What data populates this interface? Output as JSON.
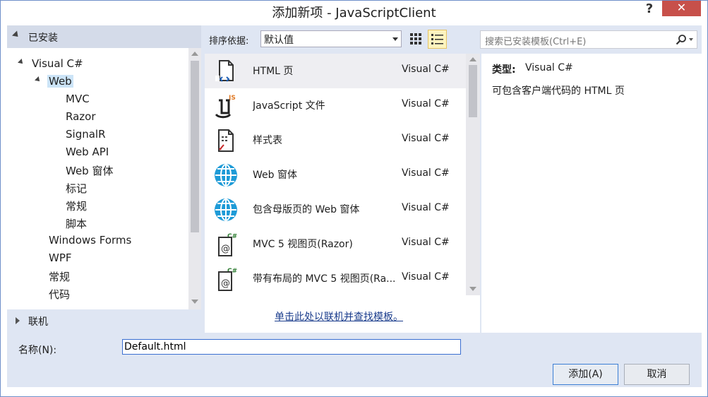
{
  "window": {
    "title": "添加新项 - JavaScriptClient",
    "help_label": "?",
    "close_label": "✕"
  },
  "left": {
    "installed_label": "已安装",
    "tree": [
      {
        "label": "Visual C#",
        "level": 0,
        "expanded": true
      },
      {
        "label": "Web",
        "level": 1,
        "expanded": true,
        "selected": true
      },
      {
        "label": "MVC",
        "level": 2
      },
      {
        "label": "Razor",
        "level": 2
      },
      {
        "label": "SignalR",
        "level": 2
      },
      {
        "label": "Web API",
        "level": 2
      },
      {
        "label": "Web 窗体",
        "level": 2
      },
      {
        "label": "标记",
        "level": 2
      },
      {
        "label": "常规",
        "level": 2
      },
      {
        "label": "脚本",
        "level": 2
      },
      {
        "label": "Windows Forms",
        "level": 1
      },
      {
        "label": "WPF",
        "level": 1
      },
      {
        "label": "常规",
        "level": 1
      },
      {
        "label": "代码",
        "level": 1
      }
    ],
    "online_label": "联机"
  },
  "toolbar": {
    "sort_label": "排序依据:",
    "sort_value": "默认值"
  },
  "templates": [
    {
      "name": "HTML 页",
      "type": "Visual C#",
      "icon": "html-page-icon",
      "selected": true
    },
    {
      "name": "JavaScript 文件",
      "type": "Visual C#",
      "icon": "javascript-file-icon"
    },
    {
      "name": "样式表",
      "type": "Visual C#",
      "icon": "stylesheet-icon"
    },
    {
      "name": "Web 窗体",
      "type": "Visual C#",
      "icon": "globe-icon"
    },
    {
      "name": "包含母版页的 Web 窗体",
      "type": "Visual C#",
      "icon": "globe-icon"
    },
    {
      "name": "MVC 5 视图页(Razor)",
      "type": "Visual C#",
      "icon": "razor-view-icon"
    },
    {
      "name": "带有布局的 MVC 5 视图页(Ra...",
      "type": "Visual C#",
      "icon": "razor-view-icon"
    }
  ],
  "online_link": "单击此处以联机并查找模板。",
  "search": {
    "placeholder": "搜索已安装模板(Ctrl+E)"
  },
  "details": {
    "type_label": "类型:",
    "type_value": "Visual C#",
    "description": "可包含客户端代码的 HTML 页"
  },
  "bottom": {
    "name_label": "名称(N):",
    "name_value": "Default.html",
    "add_button": "添加(A)",
    "cancel_button": "取消"
  },
  "colors": {
    "accent": "#3c7fd5",
    "close_red": "#c7504a",
    "link": "#1a3c8c",
    "selected_tree": "#cce4f7",
    "globe_blue": "#1e9bd7"
  }
}
